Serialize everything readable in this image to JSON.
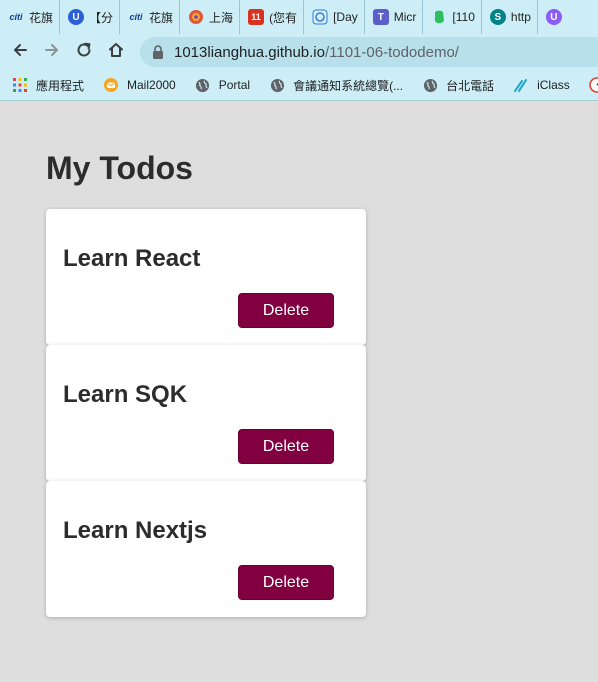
{
  "tabs": [
    {
      "icon": "citi-icon",
      "label": "花旗",
      "color": "#0a3d91"
    },
    {
      "icon": "app-icon",
      "label": "【分",
      "color": "#2b5fd9"
    },
    {
      "icon": "citi-icon",
      "label": "花旗",
      "color": "#0a3d91"
    },
    {
      "icon": "orbit-icon",
      "label": "上海",
      "color": "#e2553b"
    },
    {
      "icon": "calendar-11-icon",
      "label": "(您有",
      "color": "#d9321f"
    },
    {
      "icon": "blue-map-icon",
      "label": "[Day",
      "color": "#2d7fd1"
    },
    {
      "icon": "teams-icon",
      "label": "Micr",
      "color": "#5b5fc7"
    },
    {
      "icon": "evernote-icon",
      "label": "[110",
      "color": "#2dbe60"
    },
    {
      "icon": "sharepoint-icon",
      "label": "http",
      "color": "#038387"
    },
    {
      "icon": "purple-app-icon",
      "label": "",
      "color": "#8b5cf6"
    }
  ],
  "address_bar": {
    "host": "1013lianghua.github.io",
    "path": "/1101-06-tododemo/"
  },
  "bookmarks": [
    {
      "icon": "apps-grid-icon",
      "label": "應用程式"
    },
    {
      "icon": "mail-icon",
      "label": "Mail2000"
    },
    {
      "icon": "globe-icon",
      "label": "Portal"
    },
    {
      "icon": "globe-icon",
      "label": "會議通知系統總覽(..."
    },
    {
      "icon": "globe-icon",
      "label": "台北電話"
    },
    {
      "icon": "iclass-icon",
      "label": "iClass"
    },
    {
      "icon": "gauge-icon",
      "label": ""
    }
  ],
  "page": {
    "title": "My Todos",
    "todos": [
      {
        "text": "Learn React",
        "action": "Delete"
      },
      {
        "text": "Learn SQK",
        "action": "Delete"
      },
      {
        "text": "Learn Nextjs",
        "action": "Delete"
      }
    ]
  },
  "colors": {
    "delete_button": "#800040",
    "browser_chrome": "#cdeef7",
    "page_background": "#dedede"
  }
}
